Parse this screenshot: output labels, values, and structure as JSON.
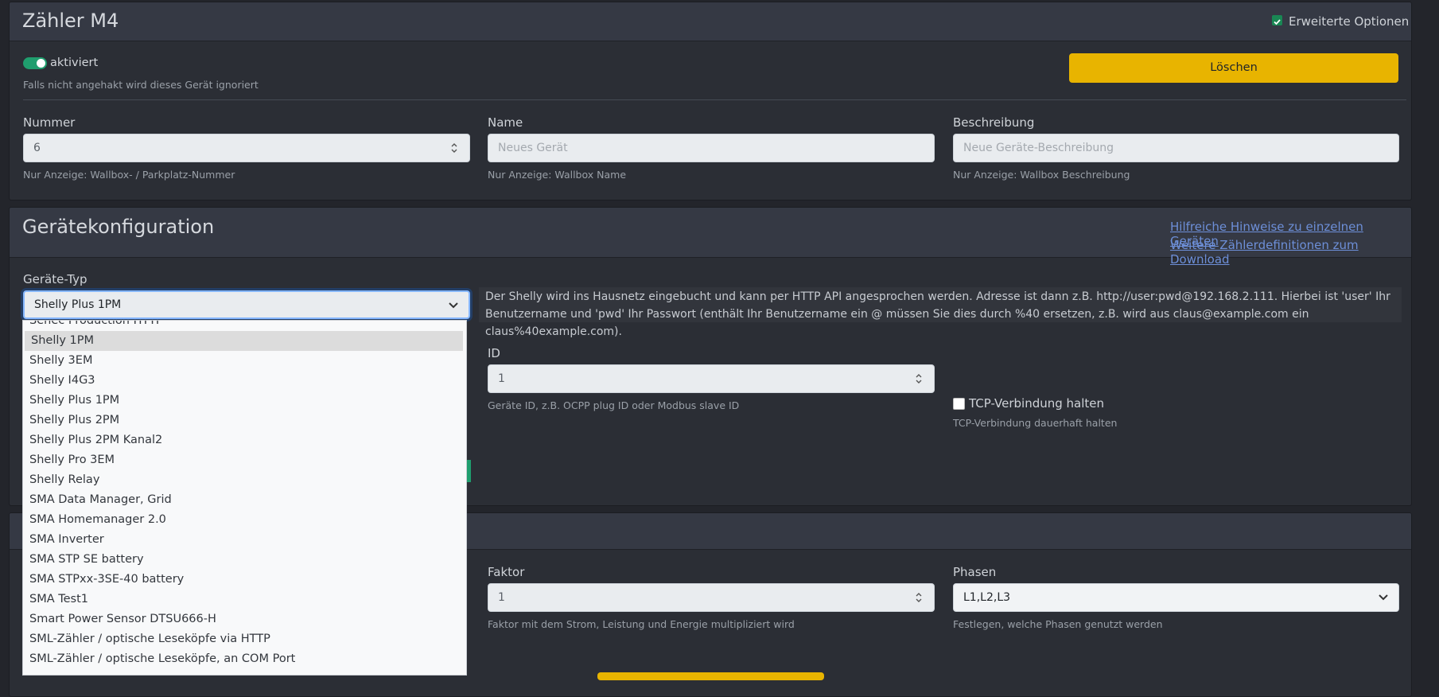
{
  "meter_card": {
    "title": "Zähler M4",
    "advanced_options": {
      "label": "Erweiterte Optionen",
      "checked": true
    },
    "enabled": {
      "label": "aktiviert",
      "help": "Falls nicht angehakt wird dieses Gerät ignoriert",
      "on": true
    },
    "delete_button": "Löschen",
    "nummer": {
      "label": "Nummer",
      "value": "6",
      "help": "Nur Anzeige: Wallbox- / Parkplatz-Nummer"
    },
    "name": {
      "label": "Name",
      "placeholder": "Neues Gerät",
      "help": "Nur Anzeige: Wallbox Name"
    },
    "beschreibung": {
      "label": "Beschreibung",
      "placeholder": "Neue Geräte-Beschreibung",
      "help": "Nur Anzeige: Wallbox Beschreibung"
    }
  },
  "device_config": {
    "title": "Gerätekonfiguration",
    "links": [
      "Hilfreiche Hinweise zu einzelnen Geräten",
      "Weitere Zählerdefinitionen zum Download"
    ],
    "device_type": {
      "label": "Geräte-Typ",
      "value": "Shelly Plus 1PM"
    },
    "description": "Der Shelly wird ins Hausnetz eingebucht und kann per HTTP API angesprochen werden. Adresse ist dann z.B. http://user:pwd@192.168.2.111. Hierbei ist 'user' Ihr Benutzername und 'pwd' Ihr Passwort (enthält Ihr Benutzername ein @ müssen Sie dies durch %40 ersetzen, z.B. wird aus claus@example.com ein claus%40example.com).",
    "id": {
      "label": "ID",
      "value": "1",
      "help": "Geräte ID, z.B. OCPP plug ID oder Modbus slave ID"
    },
    "tcp": {
      "label": "TCP-Verbindung halten",
      "help": "TCP-Verbindung dauerhaft halten",
      "checked": false
    }
  },
  "third_card": {
    "faktor": {
      "label": "Faktor",
      "value": "1",
      "help": "Faktor mit dem Strom, Leistung und Energie multipliziert wird"
    },
    "phasen": {
      "label": "Phasen",
      "value": "L1,L2,L3",
      "help": "Festlegen, welche Phasen genutzt werden"
    }
  },
  "dropdown": {
    "selected": "Shelly 1PM",
    "items": [
      "Senec Production HTTP",
      "Shelly 1PM",
      "Shelly 3EM",
      "Shelly I4G3",
      "Shelly Plus 1PM",
      "Shelly Plus 2PM",
      "Shelly Plus 2PM Kanal2",
      "Shelly Pro 3EM",
      "Shelly Relay",
      "SMA Data Manager, Grid",
      "SMA Homemanager 2.0",
      "SMA Inverter",
      "SMA STP SE battery",
      "SMA STPxx-3SE-40 battery",
      "SMA Test1",
      "Smart Power Sensor DTSU666-H",
      "SML-Zähler / optische Leseköpfe via HTTP",
      "SML-Zähler / optische Leseköpfe, an COM Port"
    ]
  },
  "colors": {
    "accent_yellow": "#e8b400",
    "toggle_green": "#1f9e6e",
    "link_blue": "#6d8fd8"
  }
}
